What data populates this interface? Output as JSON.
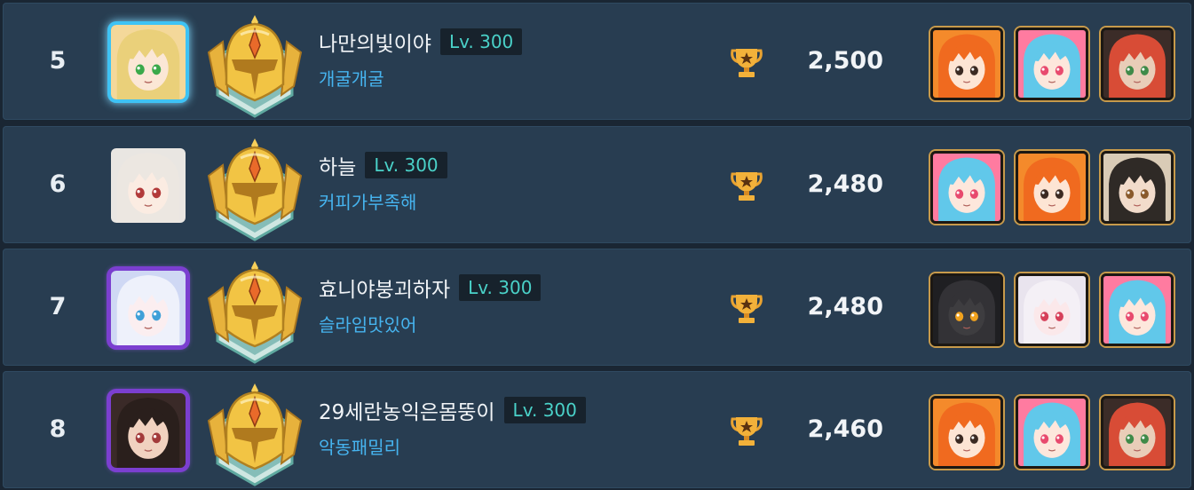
{
  "ranking": [
    {
      "rank": "5",
      "player_name": "나만의빛이야",
      "level": "Lv. 300",
      "guild": "개굴개굴",
      "avatar": {
        "icon": "blonde-hero-portrait",
        "frame": "ice",
        "bg": "#f4d89a",
        "hair": "#ead07a",
        "skin": "#fbe7d6",
        "eye": "#3aa94a"
      },
      "badge_icon": "gold-helmet-badge",
      "trophy_icon": "trophy-icon",
      "score": "2,500",
      "heroes": [
        {
          "icon": "orange-hair-hero",
          "bg": "#f48a2b",
          "hair": "#f06a1f",
          "skin": "#fde5d4",
          "eye": "#3b2a22"
        },
        {
          "icon": "blue-hair-hero",
          "bg": "#ff7ba0",
          "hair": "#61c8ea",
          "skin": "#fde7dc",
          "eye": "#e84a6e"
        },
        {
          "icon": "dark-hat-hero",
          "bg": "#3b2c28",
          "hair": "#d84c36",
          "skin": "#e9cdb8",
          "eye": "#3f8a48"
        }
      ]
    },
    {
      "rank": "6",
      "player_name": "하늘",
      "level": "Lv. 300",
      "guild": "커피가부족해",
      "avatar": {
        "icon": "silver-hair-hero-portrait",
        "frame": "none",
        "bg": "#e9e6e2",
        "hair": "#ece7e1",
        "skin": "#fbece2",
        "eye": "#b23a3a"
      },
      "badge_icon": "gold-helmet-badge",
      "trophy_icon": "trophy-icon",
      "score": "2,480",
      "heroes": [
        {
          "icon": "blue-hair-hero",
          "bg": "#ff7ba0",
          "hair": "#61c8ea",
          "skin": "#fde7dc",
          "eye": "#e84a6e"
        },
        {
          "icon": "orange-hair-hero",
          "bg": "#f48a2b",
          "hair": "#f06a1f",
          "skin": "#fde5d4",
          "eye": "#3b2a22"
        },
        {
          "icon": "dark-hair-hero",
          "bg": "#d9cbb6",
          "hair": "#2f2a26",
          "skin": "#f2dccb",
          "eye": "#8a5a2c"
        }
      ]
    },
    {
      "rank": "7",
      "player_name": "효니야붕괴하자",
      "level": "Lv. 300",
      "guild": "슬라임맛있어",
      "avatar": {
        "icon": "white-hair-hero-portrait",
        "frame": "purple",
        "bg": "#cfd8f4",
        "hair": "#eef1fb",
        "skin": "#fbeef0",
        "eye": "#3fa0d8"
      },
      "badge_icon": "gold-helmet-badge",
      "trophy_icon": "trophy-icon",
      "score": "2,480",
      "heroes": [
        {
          "icon": "dark-armor-hero",
          "bg": "#1f1f22",
          "hair": "#333236",
          "skin": "#3e3d40",
          "eye": "#f0a21e"
        },
        {
          "icon": "white-hair-hero",
          "bg": "#e9e4ee",
          "hair": "#f4f0f6",
          "skin": "#fbe8ea",
          "eye": "#d6405a"
        },
        {
          "icon": "blue-hair-hero",
          "bg": "#ff7ba0",
          "hair": "#61c8ea",
          "skin": "#fde7dc",
          "eye": "#e84a6e"
        }
      ]
    },
    {
      "rank": "8",
      "player_name": "29세란농익은몸뚱이",
      "level": "Lv. 300",
      "guild": "악동패밀리",
      "avatar": {
        "icon": "dark-hair-hero-portrait",
        "frame": "purple",
        "bg": "#3a2a28",
        "hair": "#2a1f1c",
        "skin": "#f1d2c0",
        "eye": "#a33b3b"
      },
      "badge_icon": "gold-helmet-badge",
      "trophy_icon": "trophy-icon",
      "score": "2,460",
      "heroes": [
        {
          "icon": "orange-hair-hero",
          "bg": "#f48a2b",
          "hair": "#f06a1f",
          "skin": "#fde5d4",
          "eye": "#3b2a22"
        },
        {
          "icon": "blue-hair-hero",
          "bg": "#ff7ba0",
          "hair": "#61c8ea",
          "skin": "#fde7dc",
          "eye": "#e84a6e"
        },
        {
          "icon": "dark-hat-hero",
          "bg": "#3b2c28",
          "hair": "#d84c36",
          "skin": "#e9cdb8",
          "eye": "#3f8a48"
        }
      ]
    }
  ]
}
